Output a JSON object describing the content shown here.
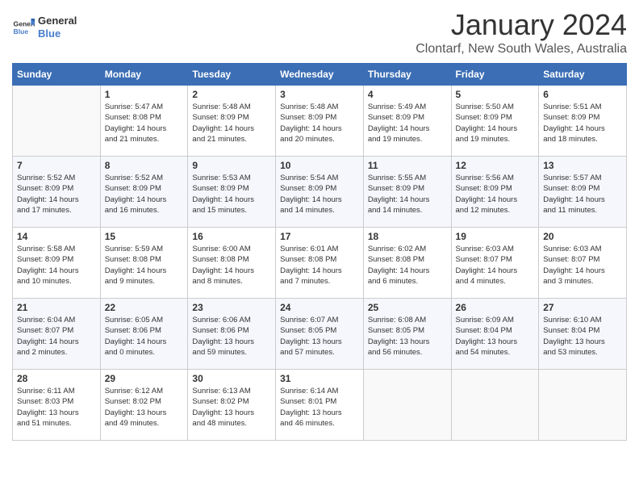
{
  "logo": {
    "line1": "General",
    "line2": "Blue"
  },
  "title": "January 2024",
  "subtitle": "Clontarf, New South Wales, Australia",
  "days_of_week": [
    "Sunday",
    "Monday",
    "Tuesday",
    "Wednesday",
    "Thursday",
    "Friday",
    "Saturday"
  ],
  "weeks": [
    [
      {
        "day": "",
        "info": ""
      },
      {
        "day": "1",
        "info": "Sunrise: 5:47 AM\nSunset: 8:08 PM\nDaylight: 14 hours\nand 21 minutes."
      },
      {
        "day": "2",
        "info": "Sunrise: 5:48 AM\nSunset: 8:09 PM\nDaylight: 14 hours\nand 21 minutes."
      },
      {
        "day": "3",
        "info": "Sunrise: 5:48 AM\nSunset: 8:09 PM\nDaylight: 14 hours\nand 20 minutes."
      },
      {
        "day": "4",
        "info": "Sunrise: 5:49 AM\nSunset: 8:09 PM\nDaylight: 14 hours\nand 19 minutes."
      },
      {
        "day": "5",
        "info": "Sunrise: 5:50 AM\nSunset: 8:09 PM\nDaylight: 14 hours\nand 19 minutes."
      },
      {
        "day": "6",
        "info": "Sunrise: 5:51 AM\nSunset: 8:09 PM\nDaylight: 14 hours\nand 18 minutes."
      }
    ],
    [
      {
        "day": "7",
        "info": "Sunrise: 5:52 AM\nSunset: 8:09 PM\nDaylight: 14 hours\nand 17 minutes."
      },
      {
        "day": "8",
        "info": "Sunrise: 5:52 AM\nSunset: 8:09 PM\nDaylight: 14 hours\nand 16 minutes."
      },
      {
        "day": "9",
        "info": "Sunrise: 5:53 AM\nSunset: 8:09 PM\nDaylight: 14 hours\nand 15 minutes."
      },
      {
        "day": "10",
        "info": "Sunrise: 5:54 AM\nSunset: 8:09 PM\nDaylight: 14 hours\nand 14 minutes."
      },
      {
        "day": "11",
        "info": "Sunrise: 5:55 AM\nSunset: 8:09 PM\nDaylight: 14 hours\nand 14 minutes."
      },
      {
        "day": "12",
        "info": "Sunrise: 5:56 AM\nSunset: 8:09 PM\nDaylight: 14 hours\nand 12 minutes."
      },
      {
        "day": "13",
        "info": "Sunrise: 5:57 AM\nSunset: 8:09 PM\nDaylight: 14 hours\nand 11 minutes."
      }
    ],
    [
      {
        "day": "14",
        "info": "Sunrise: 5:58 AM\nSunset: 8:09 PM\nDaylight: 14 hours\nand 10 minutes."
      },
      {
        "day": "15",
        "info": "Sunrise: 5:59 AM\nSunset: 8:08 PM\nDaylight: 14 hours\nand 9 minutes."
      },
      {
        "day": "16",
        "info": "Sunrise: 6:00 AM\nSunset: 8:08 PM\nDaylight: 14 hours\nand 8 minutes."
      },
      {
        "day": "17",
        "info": "Sunrise: 6:01 AM\nSunset: 8:08 PM\nDaylight: 14 hours\nand 7 minutes."
      },
      {
        "day": "18",
        "info": "Sunrise: 6:02 AM\nSunset: 8:08 PM\nDaylight: 14 hours\nand 6 minutes."
      },
      {
        "day": "19",
        "info": "Sunrise: 6:03 AM\nSunset: 8:07 PM\nDaylight: 14 hours\nand 4 minutes."
      },
      {
        "day": "20",
        "info": "Sunrise: 6:03 AM\nSunset: 8:07 PM\nDaylight: 14 hours\nand 3 minutes."
      }
    ],
    [
      {
        "day": "21",
        "info": "Sunrise: 6:04 AM\nSunset: 8:07 PM\nDaylight: 14 hours\nand 2 minutes."
      },
      {
        "day": "22",
        "info": "Sunrise: 6:05 AM\nSunset: 8:06 PM\nDaylight: 14 hours\nand 0 minutes."
      },
      {
        "day": "23",
        "info": "Sunrise: 6:06 AM\nSunset: 8:06 PM\nDaylight: 13 hours\nand 59 minutes."
      },
      {
        "day": "24",
        "info": "Sunrise: 6:07 AM\nSunset: 8:05 PM\nDaylight: 13 hours\nand 57 minutes."
      },
      {
        "day": "25",
        "info": "Sunrise: 6:08 AM\nSunset: 8:05 PM\nDaylight: 13 hours\nand 56 minutes."
      },
      {
        "day": "26",
        "info": "Sunrise: 6:09 AM\nSunset: 8:04 PM\nDaylight: 13 hours\nand 54 minutes."
      },
      {
        "day": "27",
        "info": "Sunrise: 6:10 AM\nSunset: 8:04 PM\nDaylight: 13 hours\nand 53 minutes."
      }
    ],
    [
      {
        "day": "28",
        "info": "Sunrise: 6:11 AM\nSunset: 8:03 PM\nDaylight: 13 hours\nand 51 minutes."
      },
      {
        "day": "29",
        "info": "Sunrise: 6:12 AM\nSunset: 8:02 PM\nDaylight: 13 hours\nand 49 minutes."
      },
      {
        "day": "30",
        "info": "Sunrise: 6:13 AM\nSunset: 8:02 PM\nDaylight: 13 hours\nand 48 minutes."
      },
      {
        "day": "31",
        "info": "Sunrise: 6:14 AM\nSunset: 8:01 PM\nDaylight: 13 hours\nand 46 minutes."
      },
      {
        "day": "",
        "info": ""
      },
      {
        "day": "",
        "info": ""
      },
      {
        "day": "",
        "info": ""
      }
    ]
  ]
}
